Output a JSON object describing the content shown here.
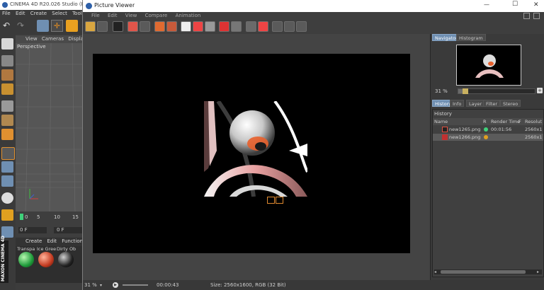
{
  "app": {
    "title": "CINEMA 4D R20.026 Studio (RC",
    "menu": [
      "File",
      "Edit",
      "Create",
      "Select",
      "Tools"
    ],
    "viewport_menu": [
      "View",
      "Cameras",
      "Display"
    ],
    "viewport_label": "Perspective",
    "timeline_ticks": [
      "0",
      "5",
      "10",
      "15"
    ],
    "frame_fields": [
      "0 F",
      "0 F"
    ],
    "material_menu": [
      "Create",
      "Edit",
      "Function"
    ],
    "materials": [
      "Transpa",
      "Ice Gree",
      "Dirty Ob"
    ],
    "brand": "MAXON CINEMA 4D"
  },
  "viewer": {
    "title": "Picture Viewer",
    "menu": [
      "File",
      "Edit",
      "View",
      "Compare",
      "Animation"
    ],
    "window_controls": {
      "minimize": "—",
      "maximize": "☐",
      "close": "✕"
    },
    "status": {
      "zoom": "31 %",
      "time": "00:00:43",
      "info": "Size: 2560x1600, RGB (32 Bit)"
    }
  },
  "navigator": {
    "tabs": [
      "Navigator",
      "Histogram"
    ],
    "zoom": "31 %",
    "zoom_fraction": 0.06
  },
  "history": {
    "tabs": [
      "History",
      "Info",
      "Layer",
      "Filter",
      "Stereo"
    ],
    "header": "History",
    "columns": [
      "Name",
      "R",
      "Render Time",
      "F",
      "Resolut"
    ],
    "rows": [
      {
        "name": "new1265.png",
        "status_color": "#3fd17a",
        "time": "00:01:56",
        "res": "2560x1"
      },
      {
        "name": "new1266.png",
        "status_color": "#e0a020",
        "time": "",
        "res": "2560x1"
      }
    ]
  },
  "colors": {
    "accent": "#6f8fb2",
    "selection": "#5b5b5b"
  }
}
